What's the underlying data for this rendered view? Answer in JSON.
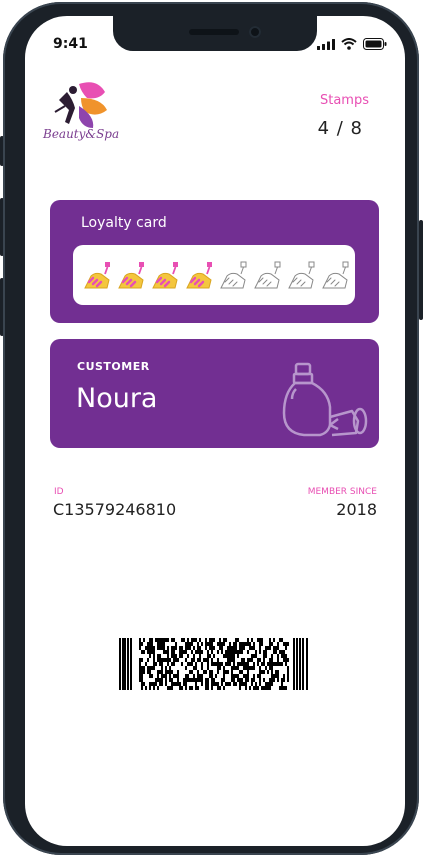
{
  "status_bar": {
    "time": "9:41",
    "icons": [
      "signal-icon",
      "wifi-icon",
      "battery-icon"
    ]
  },
  "brand": {
    "logo_text": "Beauty&Spa"
  },
  "stamps": {
    "label": "Stamps",
    "count": "4 / 8",
    "filled": 4,
    "total": 8
  },
  "loyalty_card": {
    "title": "Loyalty card"
  },
  "customer": {
    "label": "CUSTOMER",
    "name": "Noura"
  },
  "member": {
    "id_label": "ID",
    "id_value": "C13579246810",
    "since_label": "MEMBER SINCE",
    "since_value": "2018"
  },
  "colors": {
    "card": "#722f92",
    "accent": "#e84fb3",
    "phone": "#1b2128"
  }
}
